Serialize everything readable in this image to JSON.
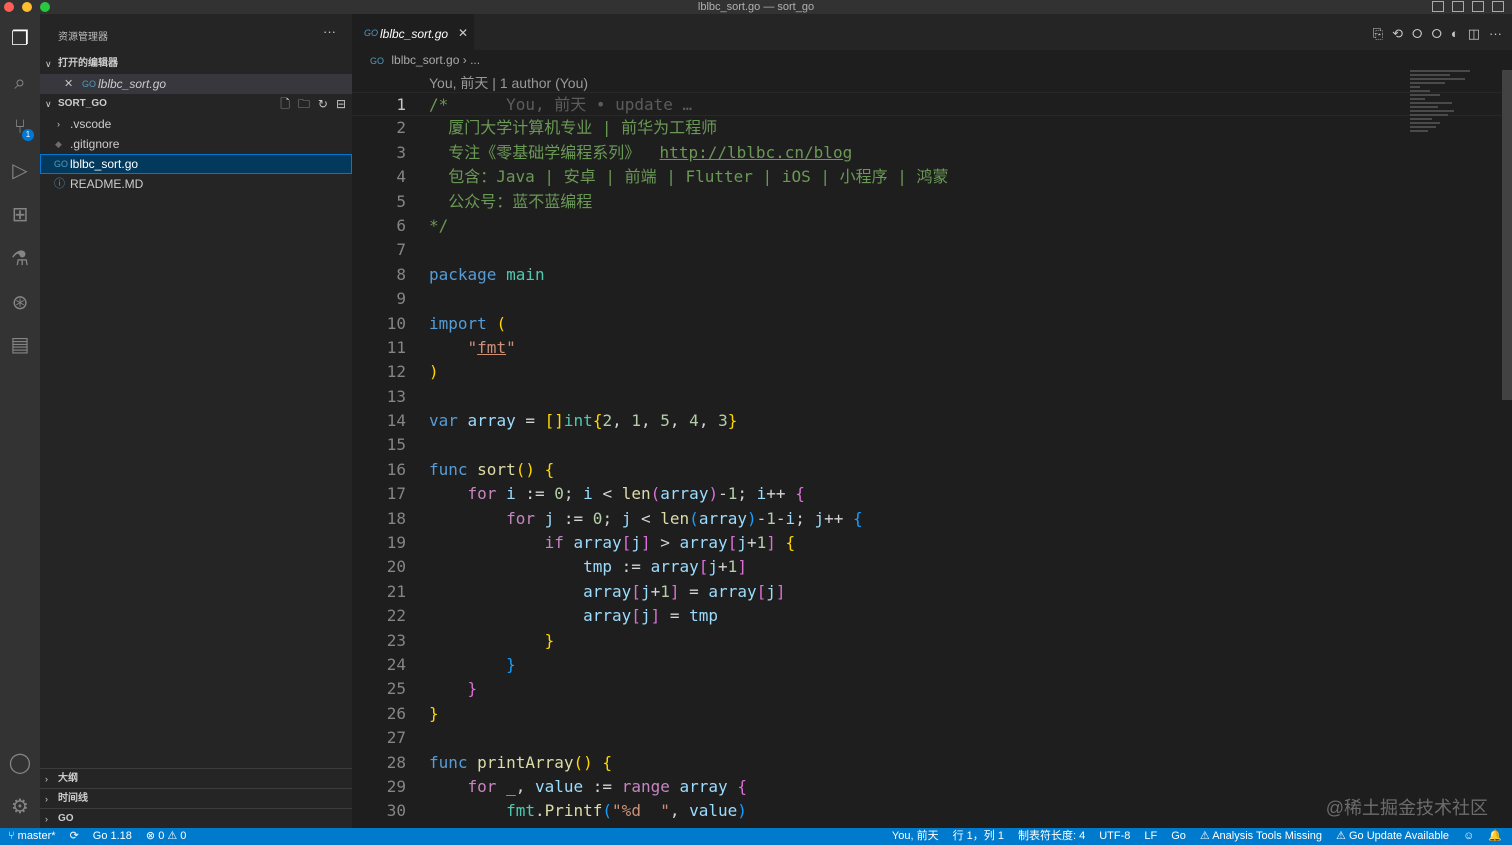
{
  "window": {
    "title": "lblbc_sort.go — sort_go"
  },
  "activity_bar": {
    "items": [
      "explorer",
      "search",
      "source-control",
      "run-debug",
      "extensions",
      "testing",
      "git-graph",
      "remote"
    ],
    "scm_badge": "1"
  },
  "sidebar": {
    "title": "资源管理器",
    "more": "···",
    "open_editors": {
      "label": "打开的编辑器",
      "files": [
        {
          "name": "lblbc_sort.go",
          "close": "✕"
        }
      ]
    },
    "workspace": {
      "label": "SORT_GO",
      "items": [
        {
          "name": ".vscode",
          "type": "folder"
        },
        {
          "name": ".gitignore",
          "type": "file"
        },
        {
          "name": "lblbc_sort.go",
          "type": "go",
          "selected": true
        },
        {
          "name": "README.MD",
          "type": "info"
        }
      ]
    },
    "bottom_sections": [
      "大纲",
      "时间线",
      "GO"
    ]
  },
  "editor": {
    "tab": {
      "label": "lblbc_sort.go",
      "icon": "GO",
      "close": "✕"
    },
    "breadcrumb": {
      "file": "lblbc_sort.go",
      "sep": "›",
      "more": "..."
    },
    "codelens": "You, 前天 | 1 author (You)",
    "ghost_text": "You, 前天 • update …",
    "line_numbers": [
      "1",
      "2",
      "3",
      "4",
      "5",
      "6",
      "7",
      "8",
      "9",
      "10",
      "11",
      "12",
      "13",
      "14",
      "15",
      "16",
      "17",
      "18",
      "19",
      "20",
      "21",
      "22",
      "23",
      "24",
      "25",
      "26",
      "27",
      "28",
      "29",
      "30"
    ],
    "lines": {
      "l2": "厦门大学计算机专业 | 前华为工程师",
      "l3a": "专注《零基础学编程系列》  ",
      "l3b": "http://lblbc.cn/blog",
      "l4": "包含：Java | 安卓 | 前端 | Flutter | iOS | 小程序 | 鸿蒙",
      "l5": "公众号：蓝不蓝编程"
    },
    "watermark": "@稀土掘金技术社区"
  },
  "colors": {
    "accent": "#007acc",
    "comment": "#6a9955",
    "keyword": "#569cd6",
    "control": "#c586c0",
    "function": "#dcdcaa",
    "string": "#ce9178",
    "number": "#b5cea8"
  },
  "statusbar": {
    "branch": "master*",
    "sync": "⟳",
    "go_version": "Go 1.18",
    "problems": "⊗ 0 ⚠ 0",
    "blame": "You, 前天",
    "position": "行 1，列 1",
    "indent": "制表符长度: 4",
    "encoding": "UTF-8",
    "eol": "LF",
    "language": "Go",
    "analysis": "⚠ Analysis Tools Missing",
    "go_update": "⚠ Go Update Available"
  }
}
